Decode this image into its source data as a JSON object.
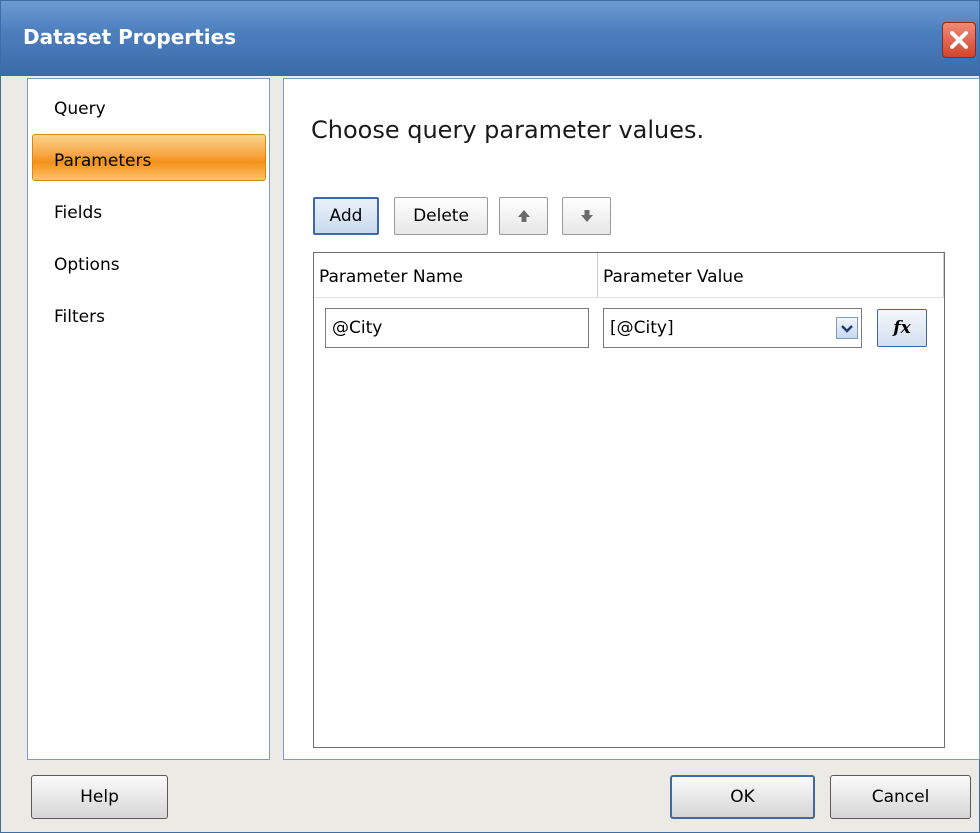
{
  "window": {
    "title": "Dataset Properties"
  },
  "sidebar": {
    "items": [
      {
        "label": "Query"
      },
      {
        "label": "Parameters",
        "selected": true
      },
      {
        "label": "Fields"
      },
      {
        "label": "Options"
      },
      {
        "label": "Filters"
      }
    ]
  },
  "content": {
    "heading": "Choose query parameter values.",
    "toolbar": {
      "add_label": "Add",
      "delete_label": "Delete",
      "move_up_icon": "arrow-up-icon",
      "move_down_icon": "arrow-down-icon"
    },
    "grid": {
      "columns": [
        "Parameter Name",
        "Parameter Value"
      ],
      "rows": [
        {
          "name": "@City",
          "value": "[@City]",
          "expression_button": "fx"
        }
      ]
    }
  },
  "footer": {
    "help_label": "Help",
    "ok_label": "OK",
    "cancel_label": "Cancel"
  },
  "colors": {
    "titlebar": "#4d7fbf",
    "selected_nav": "#f49018",
    "close_button": "#d4442c"
  }
}
